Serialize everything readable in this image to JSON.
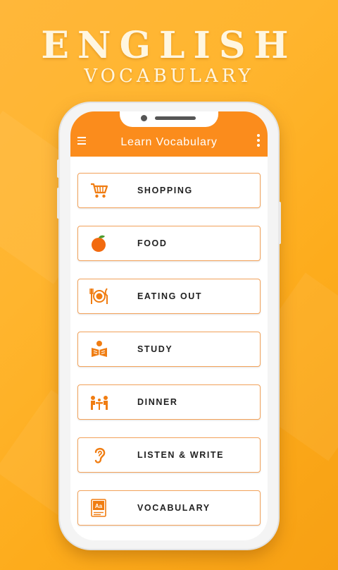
{
  "hero": {
    "title": "ENGLISH",
    "subtitle": "VOCABULARY"
  },
  "appbar": {
    "title": "Learn Vocabulary"
  },
  "categories": [
    {
      "label": "SHOPPING",
      "icon": "shopping-cart-icon"
    },
    {
      "label": "FOOD",
      "icon": "orange-fruit-icon"
    },
    {
      "label": "EATING OUT",
      "icon": "plate-cutlery-icon"
    },
    {
      "label": "STUDY",
      "icon": "person-reading-icon"
    },
    {
      "label": "DINNER",
      "icon": "dining-table-icon"
    },
    {
      "label": "LISTEN & WRITE",
      "icon": "ear-icon"
    },
    {
      "label": "VOCABULARY",
      "icon": "dictionary-icon"
    }
  ],
  "colors": {
    "accent": "#fb8c1c",
    "card_border": "#f3a25a",
    "background": "#ffb52e"
  }
}
